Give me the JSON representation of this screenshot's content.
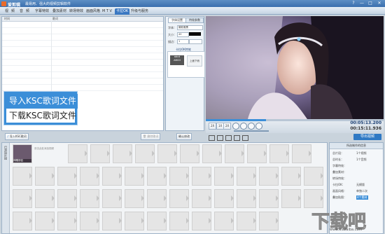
{
  "app": {
    "title": "爱剪辑",
    "slogan": "最易用、强大的视频剪辑软件"
  },
  "window_controls": [
    "?",
    "—",
    "□",
    "✕"
  ],
  "tabs": [
    {
      "label": "视",
      "active": false
    },
    {
      "label": "频",
      "active": false
    },
    {
      "label": "音",
      "active": false
    },
    {
      "label": "频",
      "active": false
    },
    {
      "label": "字幕特效",
      "active": false
    },
    {
      "label": "叠加素材",
      "active": false
    },
    {
      "label": "转场特效",
      "active": false
    },
    {
      "label": "画面风格",
      "active": false
    },
    {
      "label": "M T V",
      "active": false
    },
    {
      "label": "卡拉OK",
      "active": true
    },
    {
      "label": "升级与服务",
      "active": false
    }
  ],
  "lyrics_panel": {
    "col_time": "时间",
    "col_lyrics": "歌词",
    "import_button": "导入KSC歌词",
    "delete_button": "删除歌词"
  },
  "ksc_menu": {
    "import_item": "导入KSC歌词文件",
    "download_item": "下载KSC歌词文件"
  },
  "settings_panel": {
    "tab_font": "字体设置",
    "tab_effect": "特效参数",
    "font_label": "字体：",
    "font_value": "微软雅黑",
    "size_label": "大小：",
    "size_value": "40",
    "stroke_label": "描边：",
    "stroke_value": "1",
    "effect_section": "卡拉OK特效",
    "effect_a_line1": "abcd",
    "effect_a_line2": "ABCD",
    "effect_b": "上面下而",
    "confirm_button": "确认修改"
  },
  "preview": {
    "speed_1": "2X",
    "speed_2": "1X",
    "speed_3": "2X",
    "time_current": "00:05:13.200",
    "time_total": "00:15:11.936",
    "export_button": "导出视频"
  },
  "timeline": {
    "side_label": "已添加片段",
    "first_clip_label": "神雕侠侣",
    "second_clip_label": "双击此处添加视频"
  },
  "info_panel": {
    "header": "所选制作的信息",
    "rows": [
      {
        "label": "总片段：",
        "value": "1个视频"
      },
      {
        "label": "总时长：",
        "value": "1个音频"
      },
      {
        "label": "字幕特效：",
        "value": ""
      },
      {
        "label": "叠加素材：",
        "value": ""
      },
      {
        "label": "转场特效：",
        "value": ""
      },
      {
        "label": "卡拉OK：",
        "value": "无模版"
      },
      {
        "label": "画面风格：",
        "value": "单独二次"
      },
      {
        "label": "叠加贴图：",
        "value": "4个素材"
      }
    ]
  },
  "watermark": {
    "text": "下载吧",
    "domain": "www.xiazaiba.com"
  },
  "colors": {
    "accent": "#3b8ed8",
    "titlebar": "#3a6fae",
    "export": "#2f79c4"
  }
}
